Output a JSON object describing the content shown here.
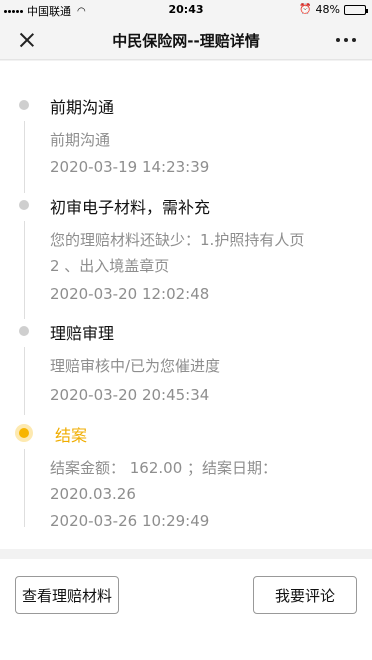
{
  "status_bar": {
    "carrier": "中国联通",
    "time": "20:43",
    "battery": "48%",
    "battery_level": 0.48
  },
  "nav": {
    "title": "中民保险网--理赔详情"
  },
  "timeline": [
    {
      "title": "前期沟通",
      "detail": "前期沟通",
      "time": "2020-03-19 14:23:39",
      "active": false
    },
    {
      "title": "初审电子材料，需补充",
      "detail": "您的理赔材料还缺少：1.护照持有人页\n2 、出入境盖章页",
      "time": "2020-03-20 12:02:48",
      "active": false
    },
    {
      "title": "理赔审理",
      "detail": "理赔审核中/已为您催进度",
      "time": "2020-03-20 20:45:34",
      "active": false
    },
    {
      "title": "结案",
      "detail": "结案金额： 162.00 ；结案日期：\n2020.03.26",
      "time": "2020-03-26 10:29:49",
      "active": true
    }
  ],
  "actions": {
    "view_materials": "查看理赔材料",
    "comment": "我要评论"
  }
}
